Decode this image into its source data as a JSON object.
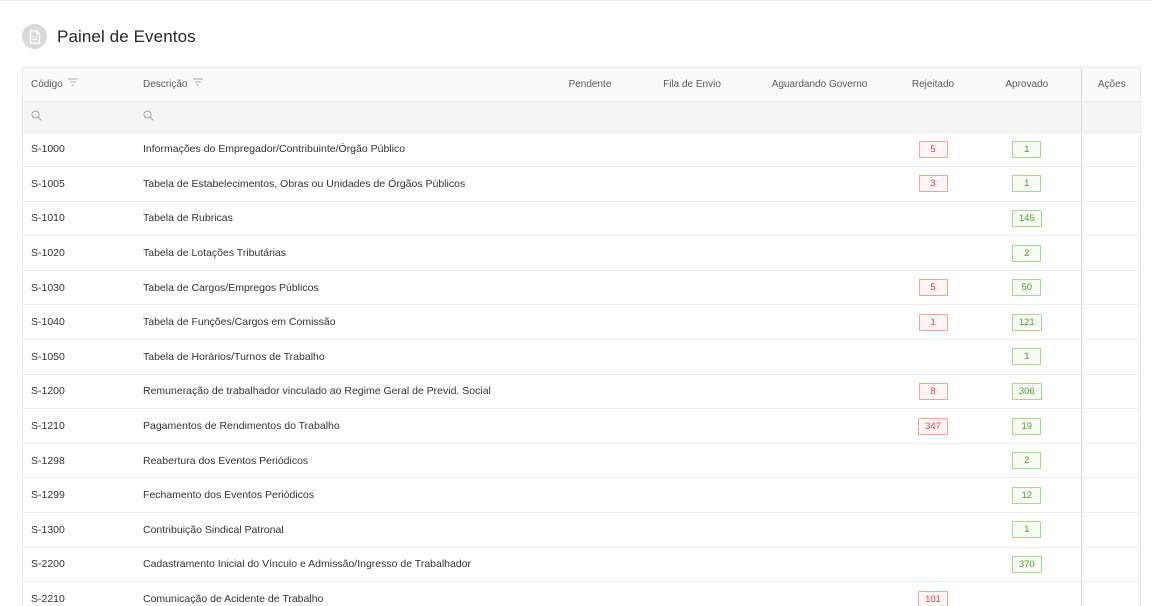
{
  "page": {
    "title": "Painel de Eventos",
    "header_icon": "document-icon"
  },
  "colors": {
    "rejected": "#e8443a",
    "approved": "#4c9a2a"
  },
  "table": {
    "headers": {
      "codigo": "Código",
      "descricao": "Descrição",
      "pendente": "Pendente",
      "fila": "Fila de Envio",
      "aguardando": "Aguardando Governo",
      "rejeitado": "Rejeitado",
      "aprovado": "Aprovado",
      "acoes": "Ações"
    },
    "rows": [
      {
        "code": "S-1000",
        "desc": "Informações do Empregador/Contribuinte/Órgão Público",
        "pendente": "",
        "fila": "",
        "aguardando": "",
        "rejeitado": "5",
        "aprovado": "1"
      },
      {
        "code": "S-1005",
        "desc": "Tabela de Estabelecimentos, Obras ou Unidades de Órgãos Públicos",
        "pendente": "",
        "fila": "",
        "aguardando": "",
        "rejeitado": "3",
        "aprovado": "1"
      },
      {
        "code": "S-1010",
        "desc": "Tabela de Rubricas",
        "pendente": "",
        "fila": "",
        "aguardando": "",
        "rejeitado": "",
        "aprovado": "145"
      },
      {
        "code": "S-1020",
        "desc": "Tabela de Lotações Tributárias",
        "pendente": "",
        "fila": "",
        "aguardando": "",
        "rejeitado": "",
        "aprovado": "2"
      },
      {
        "code": "S-1030",
        "desc": "Tabela de Cargos/Empregos Públicos",
        "pendente": "",
        "fila": "",
        "aguardando": "",
        "rejeitado": "5",
        "aprovado": "50"
      },
      {
        "code": "S-1040",
        "desc": "Tabela de Funções/Cargos em Comissão",
        "pendente": "",
        "fila": "",
        "aguardando": "",
        "rejeitado": "1",
        "aprovado": "121"
      },
      {
        "code": "S-1050",
        "desc": "Tabela de Horários/Turnos de Trabalho",
        "pendente": "",
        "fila": "",
        "aguardando": "",
        "rejeitado": "",
        "aprovado": "1"
      },
      {
        "code": "S-1200",
        "desc": "Remuneração de trabalhador vinculado ao Regime Geral de Previd. Social",
        "pendente": "",
        "fila": "",
        "aguardando": "",
        "rejeitado": "8",
        "aprovado": "306"
      },
      {
        "code": "S-1210",
        "desc": "Pagamentos de Rendimentos do Trabalho",
        "pendente": "",
        "fila": "",
        "aguardando": "",
        "rejeitado": "347",
        "aprovado": "19"
      },
      {
        "code": "S-1298",
        "desc": "Reabertura dos Eventos Periódicos",
        "pendente": "",
        "fila": "",
        "aguardando": "",
        "rejeitado": "",
        "aprovado": "2"
      },
      {
        "code": "S-1299",
        "desc": "Fechamento dos Eventos Periódicos",
        "pendente": "",
        "fila": "",
        "aguardando": "",
        "rejeitado": "",
        "aprovado": "12"
      },
      {
        "code": "S-1300",
        "desc": "Contribuição Sindical Patronal",
        "pendente": "",
        "fila": "",
        "aguardando": "",
        "rejeitado": "",
        "aprovado": "1"
      },
      {
        "code": "S-2200",
        "desc": "Cadastramento Inicial do Vínculo e Admissão/Ingresso de Trabalhador",
        "pendente": "",
        "fila": "",
        "aguardando": "",
        "rejeitado": "",
        "aprovado": "370"
      },
      {
        "code": "S-2210",
        "desc": "Comunicação de Acidente de Trabalho",
        "pendente": "",
        "fila": "",
        "aguardando": "",
        "rejeitado": "101",
        "aprovado": ""
      }
    ]
  }
}
